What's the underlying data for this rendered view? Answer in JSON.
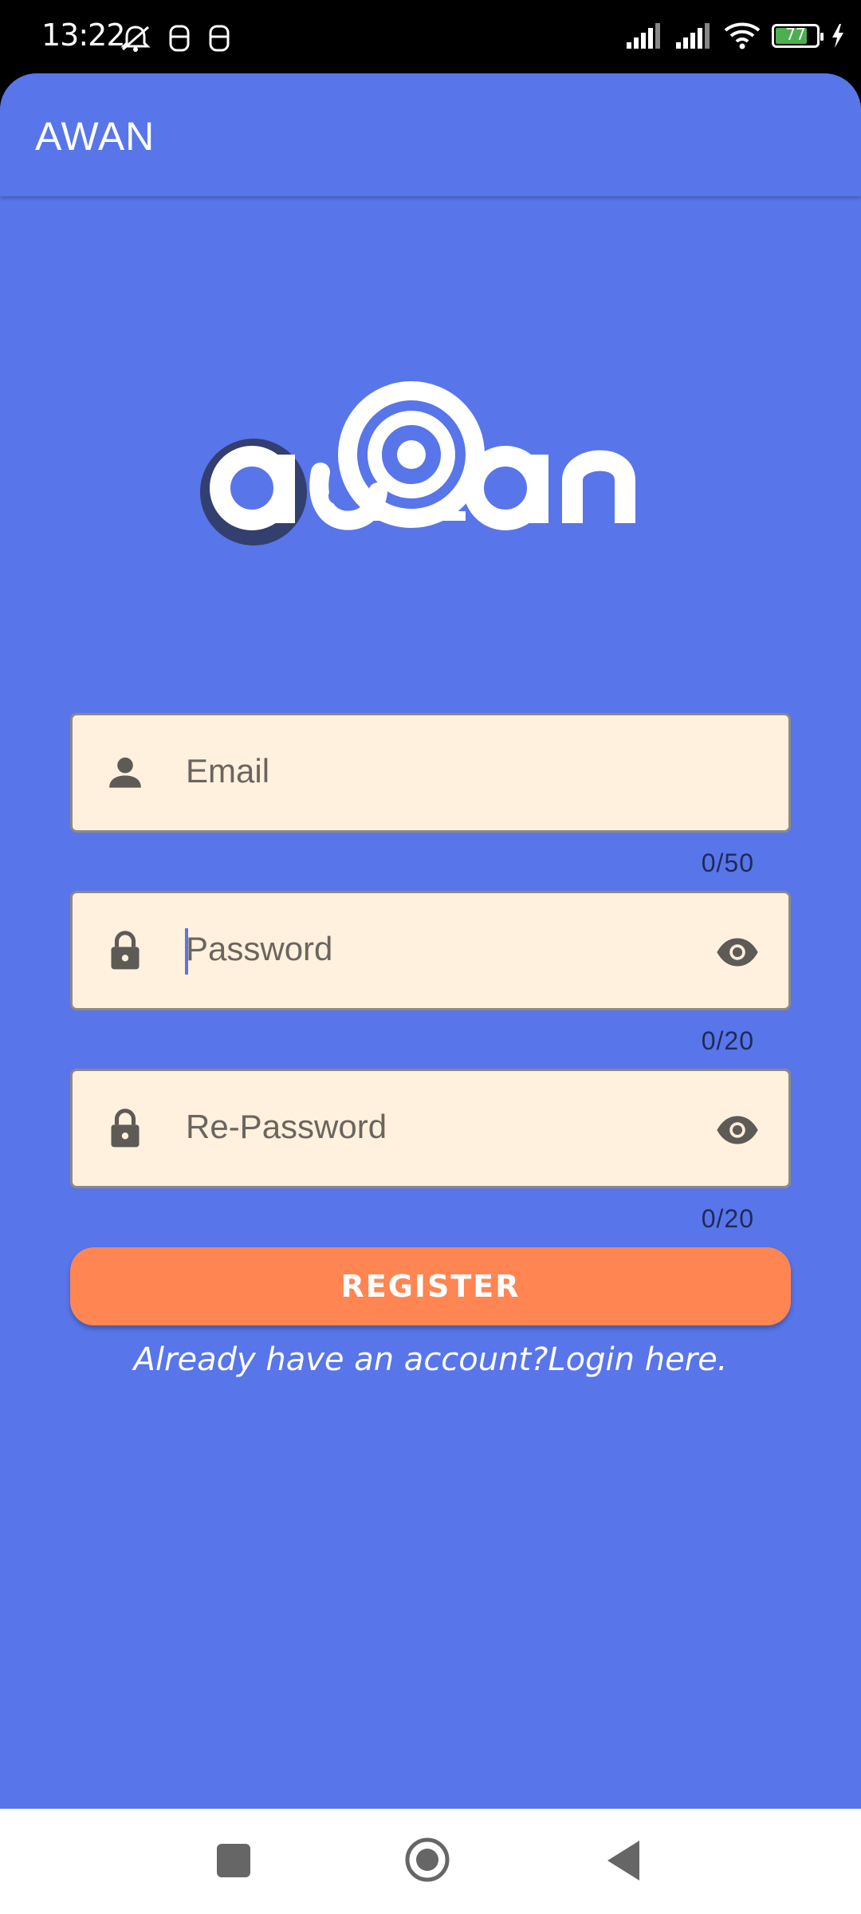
{
  "status_bar": {
    "time": "13:22",
    "battery_level": "77",
    "battery_fraction": 0.77,
    "icons": [
      "alarm-muted-icon",
      "notification-icon",
      "notification-icon",
      "signal-icon",
      "signal-icon",
      "wifi-icon",
      "battery-icon",
      "charging-icon"
    ]
  },
  "app_bar": {
    "title": "AWAN"
  },
  "logo": {
    "text": "awan"
  },
  "form": {
    "email": {
      "placeholder": "Email",
      "counter": "0/50",
      "icon": "person-icon"
    },
    "password": {
      "placeholder": "Password",
      "counter": "0/20",
      "icon": "lock-icon",
      "toggle_icon": "eye-icon"
    },
    "re_password": {
      "placeholder": "Re-Password",
      "counter": "0/20",
      "icon": "lock-icon",
      "toggle_icon": "eye-icon"
    },
    "register_label": "REGISTER",
    "login_link": "Already have an account?Login here."
  },
  "colors": {
    "background": "#5875EA",
    "field_background": "#FFF1DE",
    "button": "#FF8552",
    "text_on_primary": "#FFFFFF"
  },
  "nav_bar": {
    "icons": [
      "recents-icon",
      "home-icon",
      "back-icon"
    ]
  }
}
